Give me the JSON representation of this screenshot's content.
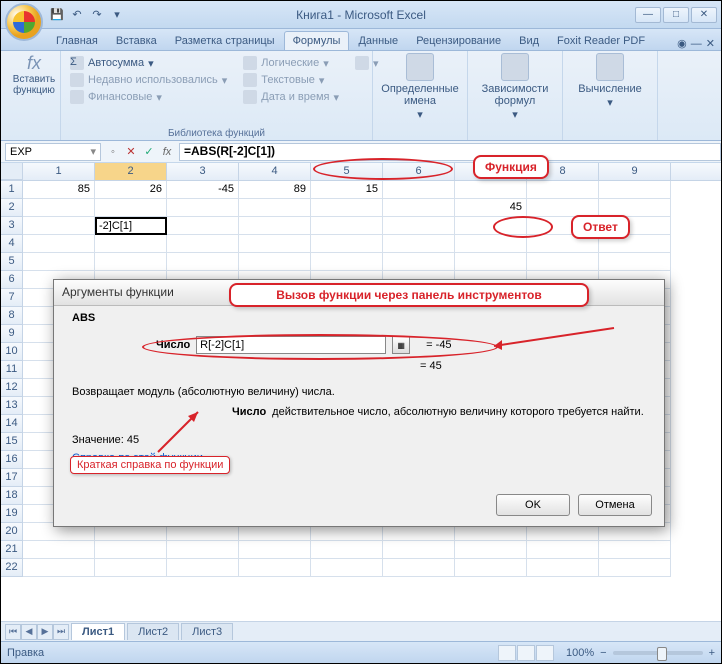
{
  "window": {
    "title": "Книга1 - Microsoft Excel"
  },
  "tabs": {
    "t0": "Главная",
    "t1": "Вставка",
    "t2": "Разметка страницы",
    "t3": "Формулы",
    "t4": "Данные",
    "t5": "Рецензирование",
    "t6": "Вид",
    "t7": "Foxit Reader PDF"
  },
  "ribbon": {
    "insert_fn": "Вставить\nфункцию",
    "autosum": "Автосумма",
    "recent": "Недавно использовались",
    "financial": "Финансовые",
    "logical": "Логические",
    "text": "Текстовые",
    "datetime": "Дата и время",
    "lib_label": "Библиотека функций",
    "def_names": "Определенные\nимена",
    "deps": "Зависимости\nформул",
    "calc": "Вычисление"
  },
  "formula_bar": {
    "name": "EXP",
    "formula": "=ABS(R[-2]C[1])",
    "fx": "fx",
    "cancel": "✕",
    "ok": "✓"
  },
  "columns": [
    "1",
    "2",
    "3",
    "4",
    "5",
    "6",
    "7",
    "8",
    "9"
  ],
  "rows": [
    "1",
    "2",
    "3",
    "4",
    "5",
    "6",
    "7",
    "8",
    "9",
    "10",
    "11",
    "12",
    "13",
    "14",
    "15",
    "16",
    "17",
    "18",
    "19",
    "20",
    "21",
    "22"
  ],
  "cells": {
    "r1": {
      "c1": "85",
      "c2": "26",
      "c3": "-45",
      "c4": "89",
      "c5": "15"
    },
    "r2": {
      "c7": "45"
    },
    "r3": {
      "c2": "-2]C[1]"
    }
  },
  "sheets": {
    "s1": "Лист1",
    "s2": "Лист2",
    "s3": "Лист3"
  },
  "status": {
    "mode": "Правка",
    "zoom": "100%",
    "minus": "−",
    "plus": "+"
  },
  "dialog": {
    "title": "Аргументы функции",
    "func": "ABS",
    "arg_label": "Число",
    "arg_value": "R[-2]C[1]",
    "arg_eval": "= -45",
    "result_line": "= 45",
    "desc": "Возвращает модуль (абсолютную величину) числа.",
    "arg_name": "Число",
    "arg_desc": "действительное число, абсолютную величину которого требуется найти.",
    "value_label": "Значение:",
    "value": "45",
    "help": "Справка по этой функции",
    "ok": "OK",
    "cancel": "Отмена"
  },
  "annot": {
    "func": "Функция",
    "answer": "Ответ",
    "call": "Вызов функции через панель инструментов",
    "brief": "Краткая справка по функции"
  }
}
